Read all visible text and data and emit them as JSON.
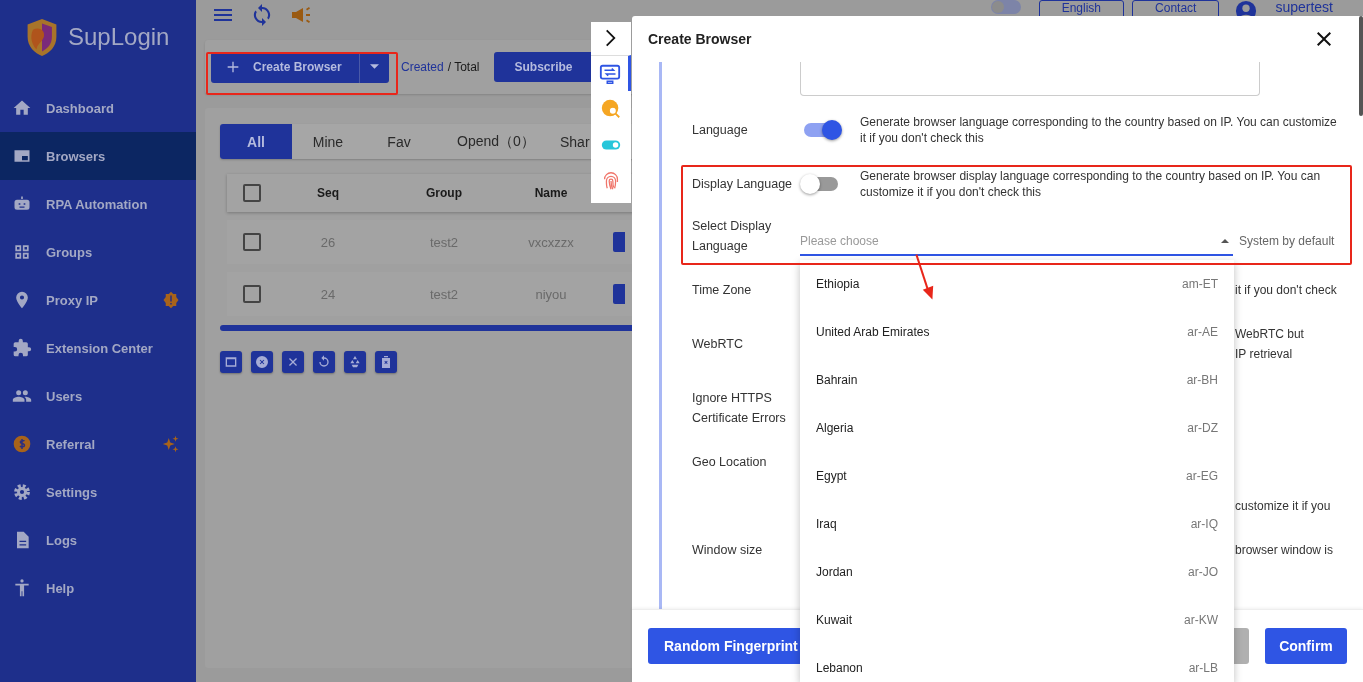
{
  "sidebar": {
    "brand": "SupLogin",
    "items": [
      {
        "label": "Dashboard",
        "selected": false
      },
      {
        "label": "Browsers",
        "selected": true
      },
      {
        "label": "RPA Automation",
        "selected": false
      },
      {
        "label": "Groups",
        "selected": false
      },
      {
        "label": "Proxy IP",
        "selected": false
      },
      {
        "label": "Extension Center",
        "selected": false
      },
      {
        "label": "Users",
        "selected": false
      },
      {
        "label": "Referral",
        "selected": false
      },
      {
        "label": "Settings",
        "selected": false
      },
      {
        "label": "Logs",
        "selected": false
      },
      {
        "label": "Help",
        "selected": false
      }
    ]
  },
  "topbar": {
    "language": "English",
    "contact": "Contact",
    "user": "supertest"
  },
  "toolbar": {
    "create_button": "Create Browser",
    "created": "Created",
    "total": "/ Total",
    "subscribe": "Subscribe"
  },
  "tabs": [
    {
      "label": "All",
      "selected": true
    },
    {
      "label": "Mine",
      "selected": false
    },
    {
      "label": "Fav",
      "selected": false
    },
    {
      "label": "Opend（0）",
      "selected": false
    },
    {
      "label": "Shar",
      "selected": false
    }
  ],
  "table": {
    "columns": [
      "Seq",
      "Group",
      "Name"
    ],
    "header_checked": false,
    "rows": [
      {
        "seq": "26",
        "group": "test2",
        "name": "vxcxzzx",
        "checked": false
      },
      {
        "seq": "24",
        "group": "test2",
        "name": "niyou",
        "checked": false
      }
    ]
  },
  "modal": {
    "title": "Create Browser",
    "rows": [
      {
        "kind": "textarea"
      },
      {
        "kind": "toggle",
        "label": "Language",
        "on": true,
        "description": "Generate browser language corresponding to the country based on IP. You can customize it if you don't check this"
      },
      {
        "kind": "toggle",
        "label": "Display Language",
        "on": false,
        "description": "Generate browser display language corresponding to the country based on IP. You can customize it if you don't check this"
      },
      {
        "kind": "select",
        "label": "Select Display Language",
        "placeholder": "Please choose",
        "hint": "System by default",
        "expanded": true
      },
      {
        "kind": "covered",
        "label": "Time Zone",
        "lines": [
          "it if you don't check"
        ]
      },
      {
        "kind": "covered",
        "label": "WebRTC",
        "lines": [
          "WebRTC but",
          "IP retrieval"
        ]
      },
      {
        "kind": "covered",
        "label": "Ignore HTTPS Certificate Errors"
      },
      {
        "kind": "covered",
        "label": "Geo Location"
      },
      {
        "kind": "covered",
        "lines": [
          "customize it if you"
        ]
      },
      {
        "kind": "covered",
        "label": "Window size",
        "lines": [
          "browser window is"
        ]
      }
    ],
    "options": [
      {
        "name": "Ethiopia",
        "code": "am-ET"
      },
      {
        "name": "United Arab Emirates",
        "code": "ar-AE"
      },
      {
        "name": "Bahrain",
        "code": "ar-BH"
      },
      {
        "name": "Algeria",
        "code": "ar-DZ"
      },
      {
        "name": "Egypt",
        "code": "ar-EG"
      },
      {
        "name": "Iraq",
        "code": "ar-IQ"
      },
      {
        "name": "Jordan",
        "code": "ar-JO"
      },
      {
        "name": "Kuwait",
        "code": "ar-KW"
      },
      {
        "name": "Lebanon",
        "code": "ar-LB"
      }
    ],
    "footer": {
      "random_button": "Random Fingerprint",
      "confirm_button": "Confirm"
    }
  }
}
